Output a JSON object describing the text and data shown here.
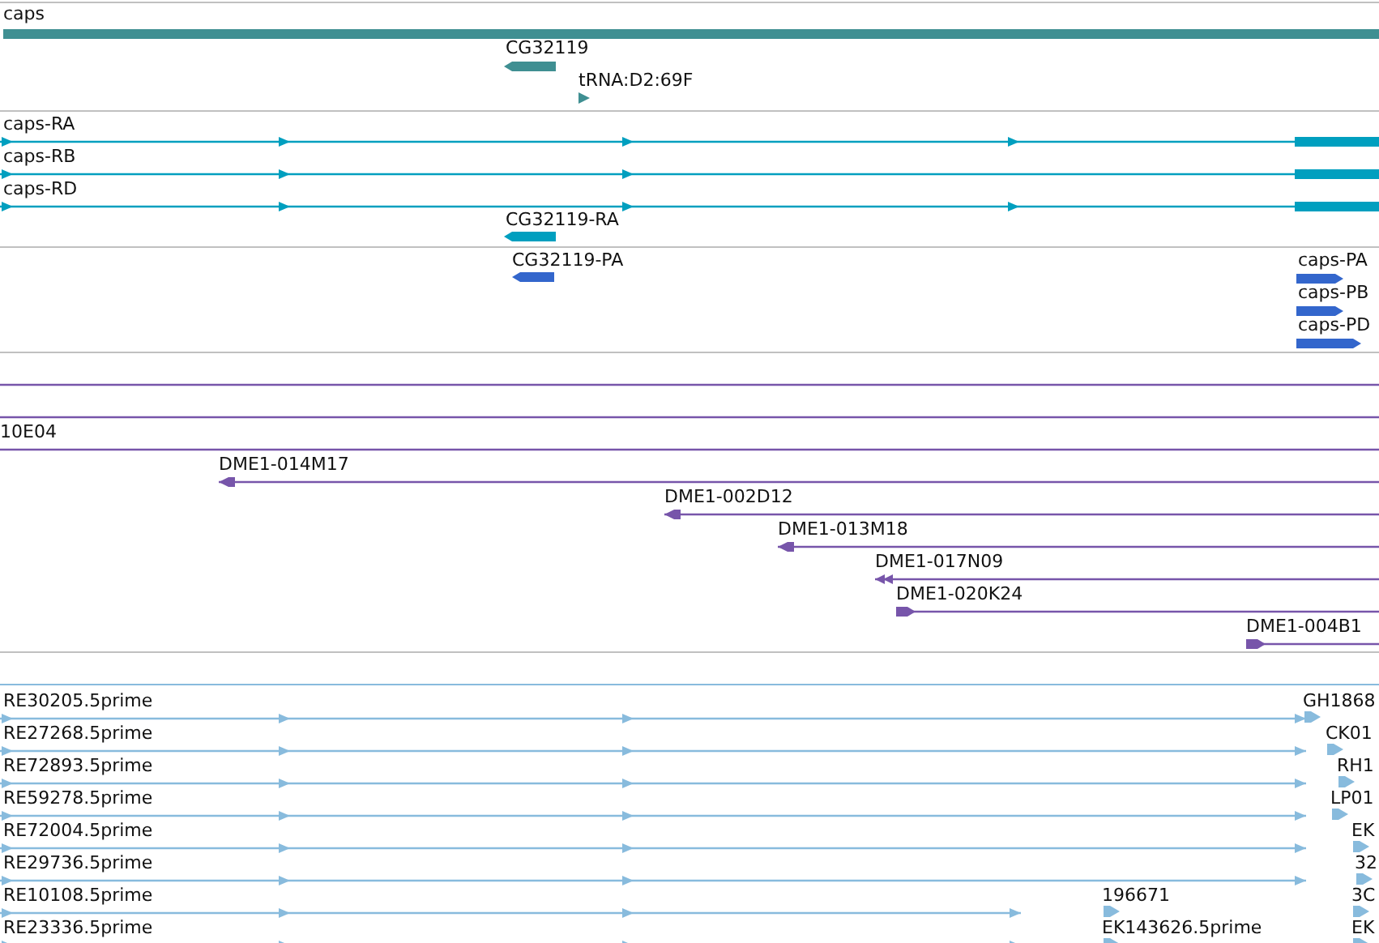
{
  "tracks": [
    {
      "kind": "gene",
      "features": [
        {
          "label": "caps",
          "kind": "span"
        },
        {
          "label": "CG32119",
          "kind": "block",
          "reverse": true
        },
        {
          "label": "tRNA:D2:69F",
          "kind": "mark",
          "reverse": false
        }
      ]
    },
    {
      "kind": "transcript",
      "features": [
        {
          "label": "caps-RA",
          "kind": "spliced",
          "reverse": false
        },
        {
          "label": "caps-RB",
          "kind": "spliced",
          "reverse": false
        },
        {
          "label": "caps-RD",
          "kind": "spliced",
          "reverse": false
        },
        {
          "label": "CG32119-RA",
          "kind": "block",
          "reverse": true
        }
      ]
    },
    {
      "kind": "protein",
      "features": [
        {
          "label": "CG32119-PA",
          "kind": "block",
          "reverse": true
        },
        {
          "label": "caps-PA",
          "kind": "block",
          "reverse": false
        },
        {
          "label": "caps-PB",
          "kind": "block",
          "reverse": false
        },
        {
          "label": "caps-PD",
          "kind": "block",
          "reverse": false
        }
      ]
    },
    {
      "kind": "clone",
      "features": [
        {
          "kind": "line"
        },
        {
          "kind": "line"
        },
        {
          "label": "10E04",
          "kind": "line"
        },
        {
          "label": "DME1-014M17",
          "kind": "line",
          "reverse": true
        },
        {
          "label": "DME1-002D12",
          "kind": "line",
          "reverse": true
        },
        {
          "label": "DME1-013M18",
          "kind": "line",
          "reverse": true
        },
        {
          "label": "DME1-017N09",
          "kind": "line",
          "reverse": true
        },
        {
          "label": "DME1-020K24",
          "kind": "line",
          "reverse": false
        },
        {
          "label": "DME1-004B1",
          "kind": "line",
          "reverse": false
        }
      ]
    },
    {
      "kind": "spacer"
    },
    {
      "kind": "est",
      "rows": [
        {
          "features": [
            {
              "label": "RE30205.5prime",
              "kind": "spliced"
            },
            {
              "label": "GH1868",
              "kind": "single"
            }
          ]
        },
        {
          "features": [
            {
              "label": "RE27268.5prime",
              "kind": "spliced"
            },
            {
              "label": "CK01",
              "kind": "single"
            }
          ]
        },
        {
          "features": [
            {
              "label": "RE72893.5prime",
              "kind": "spliced"
            },
            {
              "label": "RH1",
              "kind": "single"
            }
          ]
        },
        {
          "features": [
            {
              "label": "RE59278.5prime",
              "kind": "spliced"
            },
            {
              "label": "LP01",
              "kind": "single"
            }
          ]
        },
        {
          "features": [
            {
              "label": "RE72004.5prime",
              "kind": "spliced"
            },
            {
              "label": "EK",
              "kind": "single"
            }
          ]
        },
        {
          "features": [
            {
              "label": "RE29736.5prime",
              "kind": "spliced"
            },
            {
              "label": "32",
              "kind": "single"
            }
          ]
        },
        {
          "features": [
            {
              "label": "RE10108.5prime",
              "kind": "spliced"
            },
            {
              "label": "196671",
              "kind": "single"
            },
            {
              "label": "3C",
              "kind": "single"
            }
          ]
        },
        {
          "features": [
            {
              "label": "RE23336.5prime",
              "kind": "spliced"
            },
            {
              "label": "EK143626.5prime",
              "kind": "single"
            },
            {
              "label": "EK",
              "kind": "single"
            }
          ]
        }
      ]
    }
  ]
}
